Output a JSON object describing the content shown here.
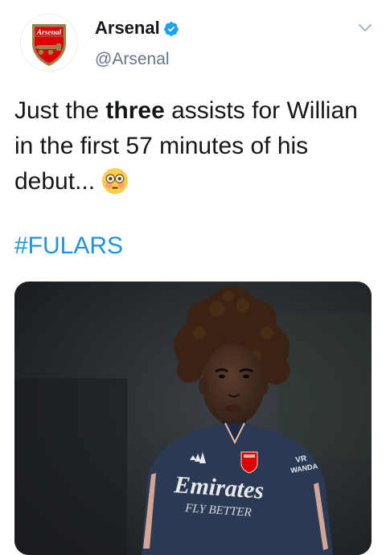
{
  "tweet": {
    "author": {
      "display_name": "Arsenal",
      "handle": "@Arsenal",
      "verified": true,
      "avatar_crest_text": "Arsenal"
    },
    "text_before": "Just the ",
    "text_bold": "three",
    "text_after": " assists for Willian in the first 57 minutes of his debut...",
    "emoji": "flushed-face",
    "hashtag": "#FULARS",
    "media": {
      "kind": "photo",
      "shirt_sponsor": "Emirates",
      "shirt_sponsor_sub": "FLY BETTER",
      "sleeve_text": "VR WANDA"
    }
  },
  "colors": {
    "verified_blue": "#1da1f2",
    "link_blue": "#1b95e0",
    "muted_gray": "#657786",
    "crest_red": "#db0007",
    "crest_gold": "#9c824a",
    "kit_navy": "#2a3a55",
    "kit_peach": "#f2b8a0"
  }
}
